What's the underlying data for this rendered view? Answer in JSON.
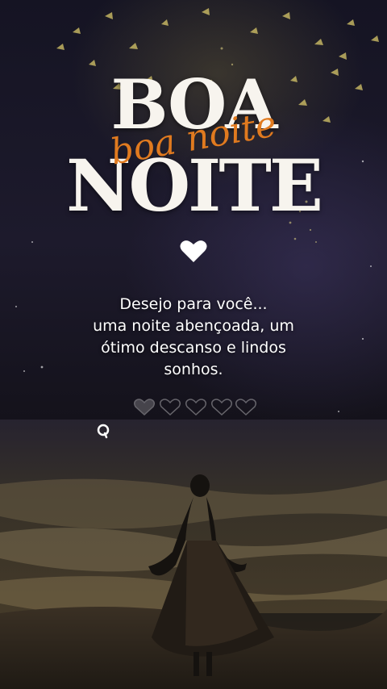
{
  "title": {
    "line1": "BOA",
    "script": "boa noite",
    "line2": "NOITE"
  },
  "message": {
    "lines": [
      "Desejo para você...",
      "uma noite abençoada, um",
      "ótimo descanso e lindos",
      "sonhos."
    ]
  },
  "icons": {
    "heart": "heart-icon",
    "hearts_row": "outline-hearts-icon",
    "search": "magnifier-icon"
  },
  "colors": {
    "title": "#f7f4ee",
    "script": "#e07a1f",
    "message": "#ffffff"
  }
}
